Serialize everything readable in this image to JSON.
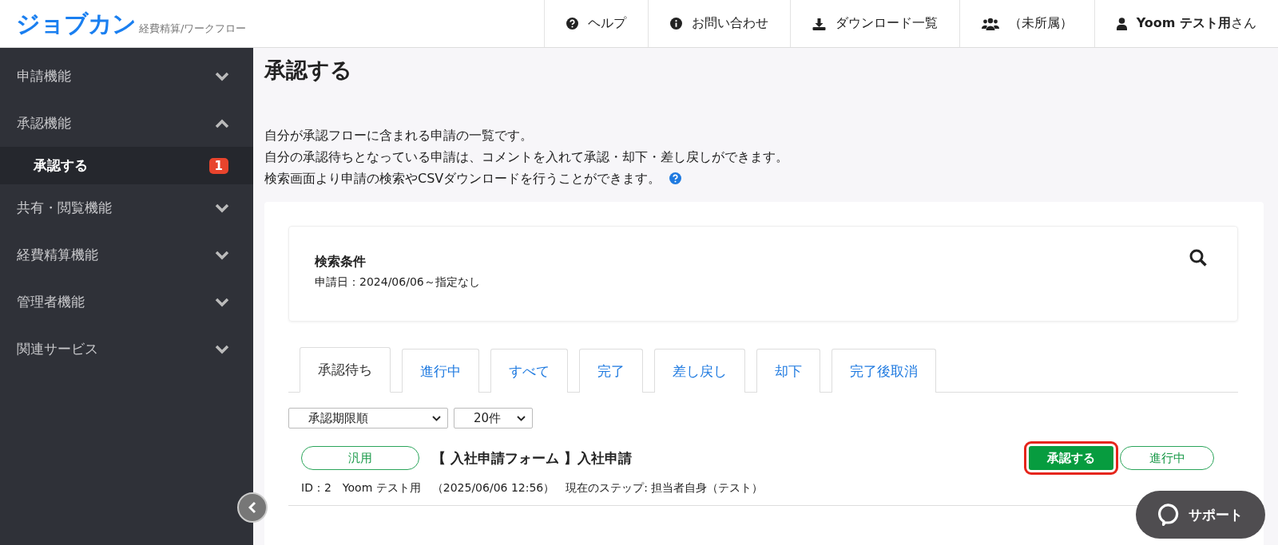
{
  "header": {
    "logo": "ジョブカン",
    "product": "経費精算/ワークフロー",
    "nav": [
      {
        "kind": "help",
        "label": "ヘルプ"
      },
      {
        "kind": "info",
        "label": "お問い合わせ"
      },
      {
        "kind": "download",
        "label": "ダウンロード一覧"
      },
      {
        "kind": "group",
        "label": "（未所属）"
      },
      {
        "kind": "user",
        "label": "**Yoom テスト用**さん"
      }
    ]
  },
  "sidebar": {
    "items": [
      {
        "label": "申請機能",
        "expanded": false
      },
      {
        "label": "承認機能",
        "expanded": true,
        "children": [
          {
            "label": "承認する",
            "selected": true,
            "badge": "1"
          }
        ]
      },
      {
        "label": "共有・閲覧機能",
        "expanded": false
      },
      {
        "label": "経費精算機能",
        "expanded": false
      },
      {
        "label": "管理者機能",
        "expanded": false
      },
      {
        "label": "関連サービス",
        "expanded": false
      }
    ]
  },
  "page": {
    "title": "承認する",
    "description": [
      "自分が承認フローに含まれる申請の一覧です。",
      "自分の承認待ちとなっている申請は、コメントを入れて承認・却下・差し戻しができます。",
      "検索画面より申請の検索やCSVダウンロードを行うことができます。"
    ],
    "search": {
      "title": "検索条件",
      "condition": "申請日：2024/06/06～指定なし"
    },
    "tabs": [
      {
        "label": "承認待ち",
        "selected": true
      },
      {
        "label": "進行中",
        "selected": false
      },
      {
        "label": "すべて",
        "selected": false
      },
      {
        "label": "完了",
        "selected": false
      },
      {
        "label": "差し戻し",
        "selected": false
      },
      {
        "label": "却下",
        "selected": false
      },
      {
        "label": "完了後取消",
        "selected": false
      }
    ],
    "sort": {
      "value": "承認期限順"
    },
    "per_page": {
      "value": "20件"
    },
    "requests": [
      {
        "category": "汎用",
        "title": "【 入社申請フォーム 】入社申請",
        "meta": [
          "ID：2",
          "Yoom テスト用",
          "（2025/06/06 12:56）",
          "現在のステップ: 担当者自身（テスト）"
        ],
        "actions": [
          {
            "kind": "primary",
            "label": "承認する",
            "highlighted": true
          },
          {
            "kind": "status",
            "label": "進行中",
            "highlighted": false
          }
        ]
      }
    ]
  },
  "support_button": {
    "label": "サポート"
  }
}
